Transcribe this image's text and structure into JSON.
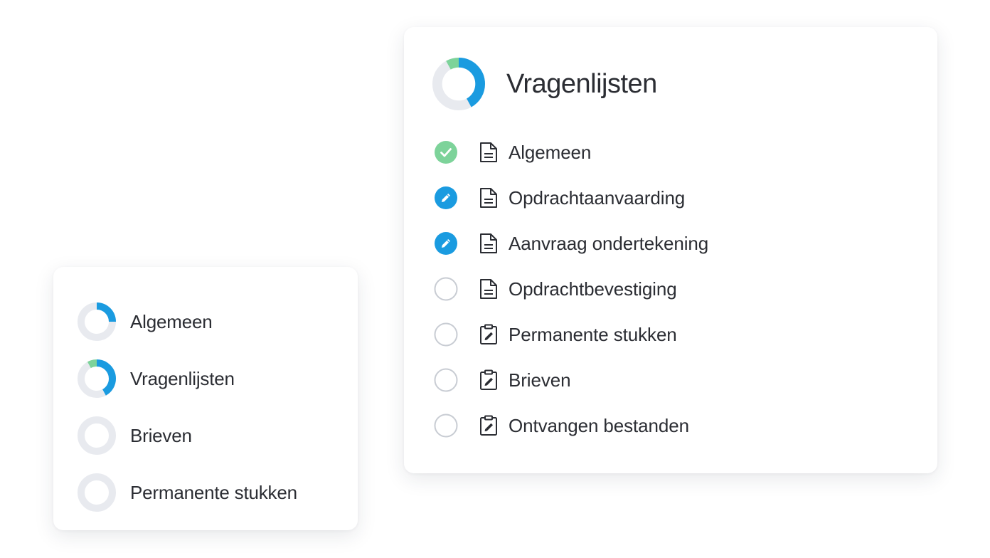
{
  "colors": {
    "blue": "#1a9be0",
    "green": "#7dd39a",
    "track": "#e8eaef",
    "empty_ring": "#c8ccd3",
    "text": "#2b2d33"
  },
  "overview": {
    "items": [
      {
        "label": "Algemeen",
        "progress": {
          "blue": 0.25,
          "green": 0
        }
      },
      {
        "label": "Vragenlijsten",
        "progress": {
          "blue": 0.42,
          "green": 0.08
        }
      },
      {
        "label": "Brieven",
        "progress": {
          "blue": 0,
          "green": 0
        }
      },
      {
        "label": "Permanente stukken",
        "progress": {
          "blue": 0,
          "green": 0
        }
      }
    ]
  },
  "questionnaires": {
    "title": "Vragenlijsten",
    "progress": {
      "blue": 0.42,
      "green": 0.08
    },
    "items": [
      {
        "label": "Algemeen",
        "status": "completed",
        "status_icon": "check-icon",
        "doc_icon": "document-icon"
      },
      {
        "label": "Opdrachtaanvaarding",
        "status": "in-progress",
        "status_icon": "pencil-icon",
        "doc_icon": "document-icon"
      },
      {
        "label": "Aanvraag ondertekening",
        "status": "in-progress",
        "status_icon": "pencil-icon",
        "doc_icon": "document-icon"
      },
      {
        "label": "Opdrachtbevestiging",
        "status": "not-started",
        "status_icon": "empty-circle-icon",
        "doc_icon": "document-icon"
      },
      {
        "label": "Permanente stukken",
        "status": "not-started",
        "status_icon": "empty-circle-icon",
        "doc_icon": "clipboard-edit-icon"
      },
      {
        "label": "Brieven",
        "status": "not-started",
        "status_icon": "empty-circle-icon",
        "doc_icon": "clipboard-edit-icon"
      },
      {
        "label": "Ontvangen bestanden",
        "status": "not-started",
        "status_icon": "empty-circle-icon",
        "doc_icon": "clipboard-edit-icon"
      }
    ]
  }
}
